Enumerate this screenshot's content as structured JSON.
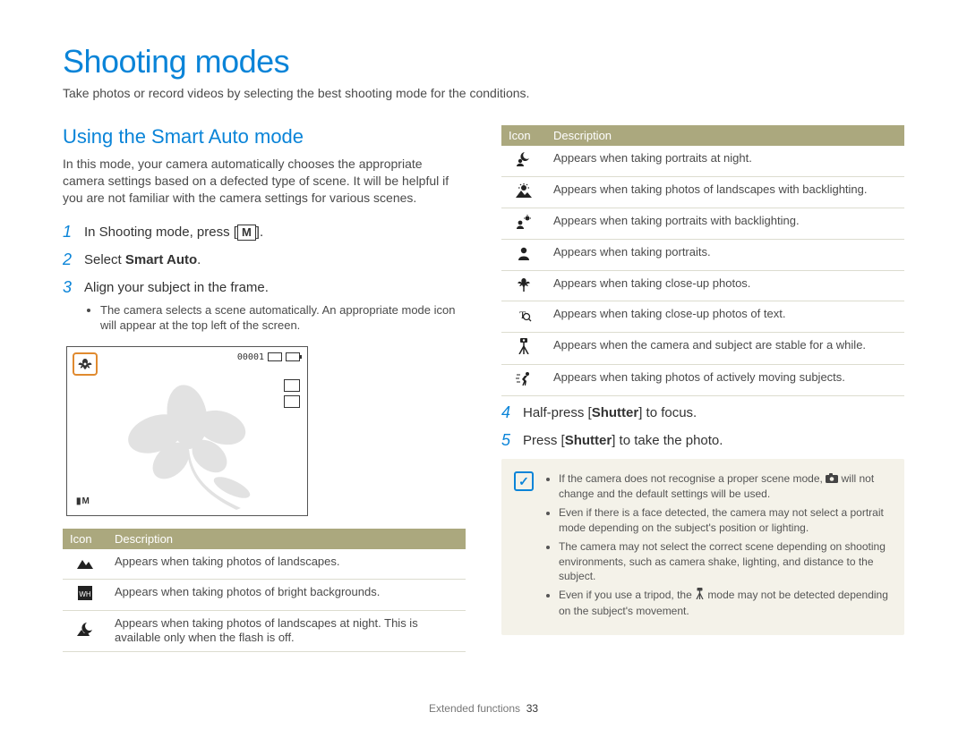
{
  "title": "Shooting modes",
  "intro": "Take photos or record videos by selecting the best shooting mode for the conditions.",
  "section": "Using the Smart Auto mode",
  "paragraph": "In this mode, your camera automatically chooses the appropriate camera settings based on a defected type of scene. It will be helpful if you are not familiar with the camera settings for various scenes.",
  "steps": {
    "s1_num": "1",
    "s1_a": "In Shooting mode, press [",
    "s1_key": "M",
    "s1_b": "].",
    "s2_num": "2",
    "s2_a": "Select ",
    "s2_b": "Smart Auto",
    "s2_c": ".",
    "s3_num": "3",
    "s3_a": "Align your subject in the frame.",
    "s3_bullet": "The camera selects a scene automatically. An appropriate mode icon will appear at the top left of the screen.",
    "s4_num": "4",
    "s4_a": "Half-press [",
    "s4_b": "Shutter",
    "s4_c": "] to focus.",
    "s5_num": "5",
    "s5_a": "Press [",
    "s5_b": "Shutter",
    "s5_c": "] to take the photo."
  },
  "screen_counter": "00001",
  "im_label": "M",
  "table_headers": {
    "icon": "Icon",
    "desc": "Description"
  },
  "left_table": [
    {
      "icon": "landscape",
      "desc": "Appears when taking photos of landscapes."
    },
    {
      "icon": "white-bg",
      "desc": "Appears when taking photos of bright backgrounds."
    },
    {
      "icon": "night-landscape",
      "desc": "Appears when taking photos of landscapes at night. This is available only when the flash is off."
    }
  ],
  "right_table": [
    {
      "icon": "night-portrait",
      "desc": "Appears when taking portraits at night."
    },
    {
      "icon": "backlight-landscape",
      "desc": "Appears when taking photos of landscapes with backlighting."
    },
    {
      "icon": "backlight-portrait",
      "desc": "Appears when taking portraits with backlighting."
    },
    {
      "icon": "portrait",
      "desc": "Appears when taking portraits."
    },
    {
      "icon": "macro",
      "desc": "Appears when taking close-up photos."
    },
    {
      "icon": "macro-text",
      "desc": "Appears when taking close-up photos of text."
    },
    {
      "icon": "tripod",
      "desc": "Appears when the camera and subject are stable for a while."
    },
    {
      "icon": "action",
      "desc": "Appears when taking photos of actively moving subjects."
    }
  ],
  "notes": {
    "n1a": "If the camera does not recognise a proper scene mode, ",
    "n1b": " will not change and the default settings will be used.",
    "n2": "Even if there is a face detected, the camera may not select a portrait mode depending on the subject's position or lighting.",
    "n3": "The camera may not select the correct scene depending on shooting environments, such as camera shake, lighting, and distance to the subject.",
    "n4a": "Even if you use a tripod, the ",
    "n4b": " mode may not be detected depending on the subject's movement."
  },
  "footer_section": "Extended functions",
  "footer_page": "33"
}
